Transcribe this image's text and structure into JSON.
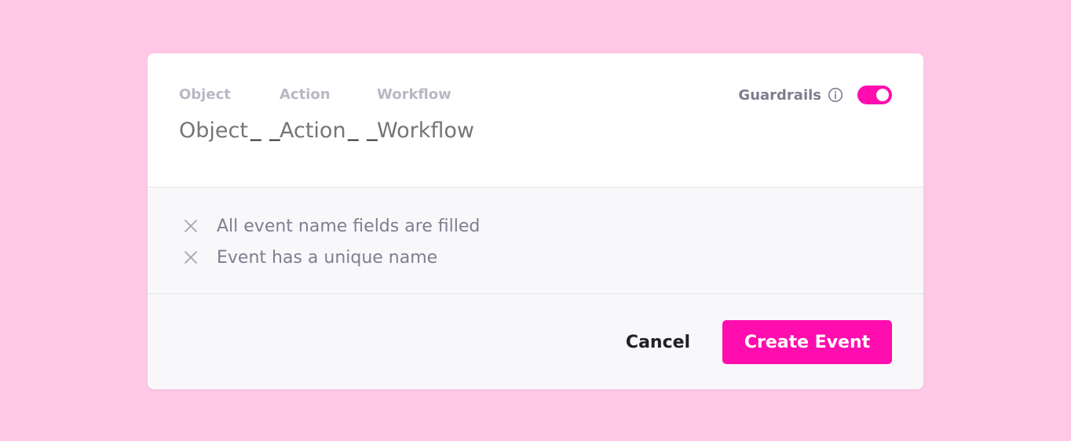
{
  "fields": {
    "object": {
      "label": "Object",
      "placeholder": "Object"
    },
    "action": {
      "label": "Action",
      "placeholder": "Action"
    },
    "workflow": {
      "label": "Workflow",
      "placeholder": "Workflow"
    },
    "separator": "_ _"
  },
  "guardrails": {
    "label": "Guardrails",
    "enabled": true,
    "info_icon": "info-icon",
    "toggle_color": "#ff0dae"
  },
  "validation": [
    {
      "icon": "close-icon",
      "text": "All event name fields are filled"
    },
    {
      "icon": "close-icon",
      "text": "Event has a unique name"
    }
  ],
  "footer": {
    "cancel_label": "Cancel",
    "create_label": "Create Event"
  },
  "colors": {
    "background": "#ffc8e6",
    "accent": "#ff0dae"
  }
}
